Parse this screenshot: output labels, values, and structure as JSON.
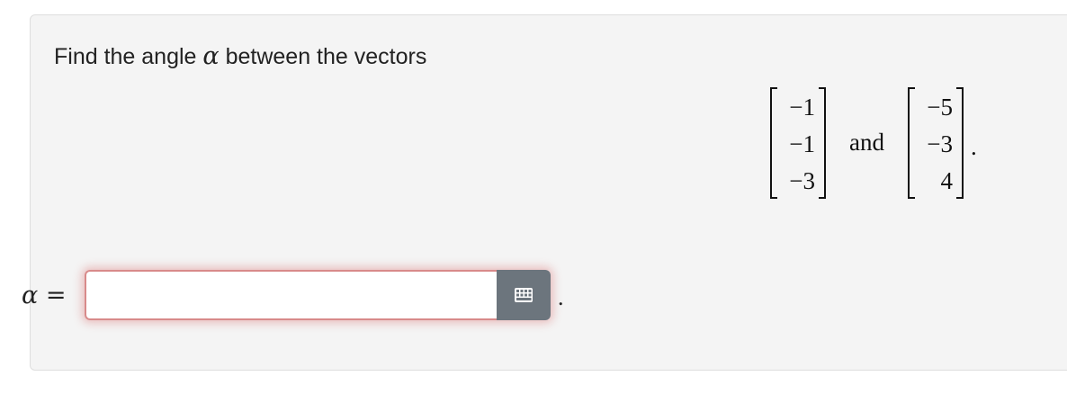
{
  "question": {
    "prefix": "Find the angle ",
    "variable": "α",
    "suffix": " between the vectors"
  },
  "vectors": {
    "first": [
      "−1",
      "−1",
      "−3"
    ],
    "connector": "and",
    "second": [
      "−5",
      "−3",
      "4"
    ],
    "end_punctuation": "."
  },
  "answer": {
    "label_var": "α",
    "label_eq": " =",
    "input_value": "",
    "keyboard_icon": "keyboard-icon",
    "trailing_punctuation": "."
  },
  "colors": {
    "card_background": "#f4f4f4",
    "input_border_invalid": "#d88a8a",
    "keyboard_button": "#6c757d"
  }
}
